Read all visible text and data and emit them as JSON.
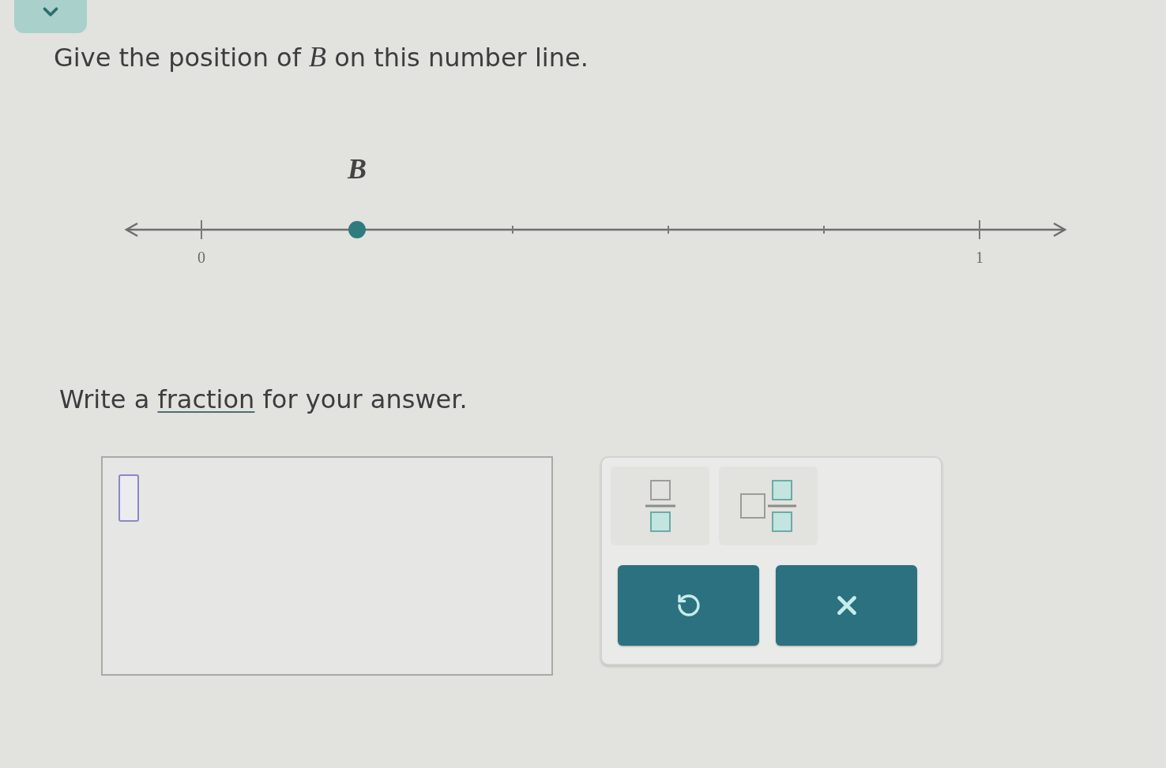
{
  "question": {
    "text": "Give the position of *B* on this number line."
  },
  "number_line": {
    "ticks": [
      {
        "kind": "major",
        "label": "0"
      },
      {
        "kind": "point",
        "label": "B"
      },
      {
        "kind": "minor"
      },
      {
        "kind": "minor"
      },
      {
        "kind": "minor"
      },
      {
        "kind": "major",
        "label": "1"
      }
    ]
  },
  "instruction": {
    "text_before": "Write a",
    "link": "fraction",
    "text_after": "for your answer."
  },
  "answer_box": {
    "slot_focused": true
  },
  "keypad": {
    "templates": [
      {
        "kind": "fraction"
      },
      {
        "kind": "mixed_number"
      }
    ],
    "actions": [
      {
        "kind": "undo"
      },
      {
        "kind": "clear"
      }
    ]
  }
}
